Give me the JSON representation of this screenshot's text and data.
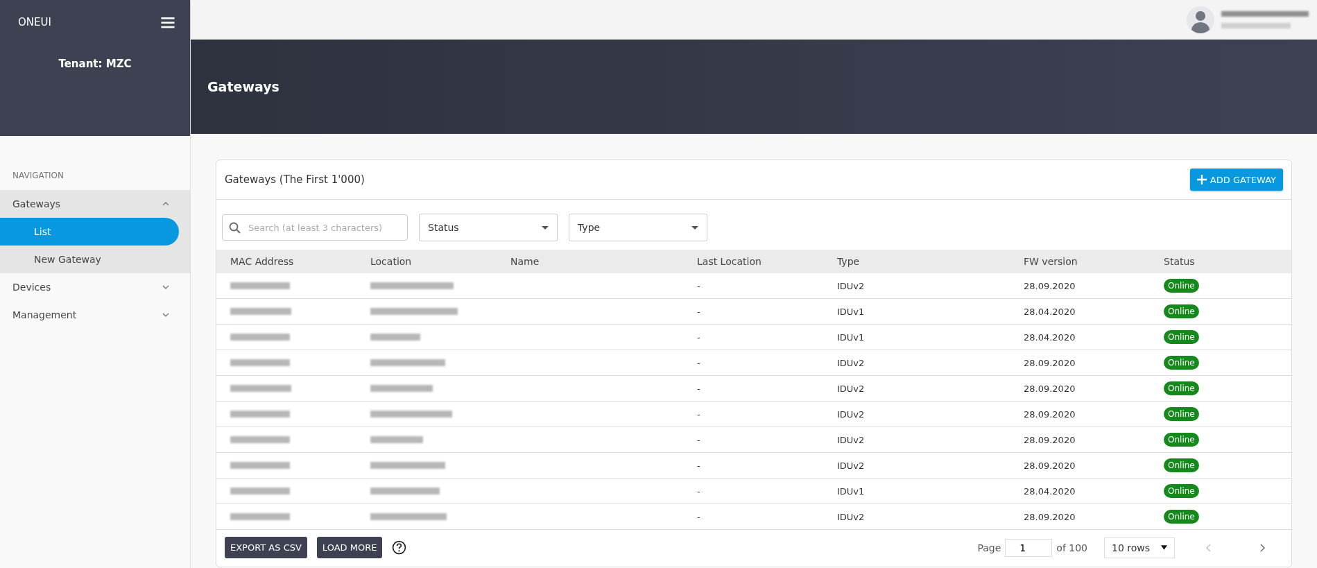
{
  "sidebar": {
    "brand": "ONEUI",
    "tenant": "Tenant: MZC",
    "section_label": "NAVIGATION",
    "items": [
      {
        "label": "Gateways",
        "expanded": true,
        "children": [
          {
            "label": "List",
            "selected": true
          },
          {
            "label": "New Gateway",
            "selected": false
          }
        ]
      },
      {
        "label": "Devices",
        "expanded": false
      },
      {
        "label": "Management",
        "expanded": false
      }
    ]
  },
  "page_title": "Gateways",
  "card": {
    "title": "Gateways (The First 1'000)",
    "add_button": "ADD GATEWAY",
    "search": {
      "placeholder": "Search (at least 3 characters)"
    },
    "filters": [
      {
        "label": "Status"
      },
      {
        "label": "Type"
      }
    ],
    "table": {
      "columns": [
        "MAC Address",
        "Location",
        "Name",
        "Last Location",
        "Type",
        "FW version",
        "Status"
      ],
      "rows": [
        {
          "last_location": "-",
          "type": "IDUv2",
          "fw_version": "28.09.2020",
          "status": "Online"
        },
        {
          "last_location": "-",
          "type": "IDUv1",
          "fw_version": "28.04.2020",
          "status": "Online"
        },
        {
          "last_location": "-",
          "type": "IDUv1",
          "fw_version": "28.04.2020",
          "status": "Online"
        },
        {
          "last_location": "-",
          "type": "IDUv2",
          "fw_version": "28.09.2020",
          "status": "Online"
        },
        {
          "last_location": "-",
          "type": "IDUv2",
          "fw_version": "28.09.2020",
          "status": "Online"
        },
        {
          "last_location": "-",
          "type": "IDUv2",
          "fw_version": "28.09.2020",
          "status": "Online"
        },
        {
          "last_location": "-",
          "type": "IDUv2",
          "fw_version": "28.09.2020",
          "status": "Online"
        },
        {
          "last_location": "-",
          "type": "IDUv2",
          "fw_version": "28.09.2020",
          "status": "Online"
        },
        {
          "last_location": "-",
          "type": "IDUv1",
          "fw_version": "28.04.2020",
          "status": "Online"
        },
        {
          "last_location": "-",
          "type": "IDUv2",
          "fw_version": "28.09.2020",
          "status": "Online"
        }
      ]
    },
    "footer": {
      "buttons": [
        "EXPORT AS CSV",
        "LOAD MORE"
      ],
      "page_label": "Page",
      "page_value": "1",
      "page_total": "of 100",
      "rows_select": "10 rows"
    }
  }
}
